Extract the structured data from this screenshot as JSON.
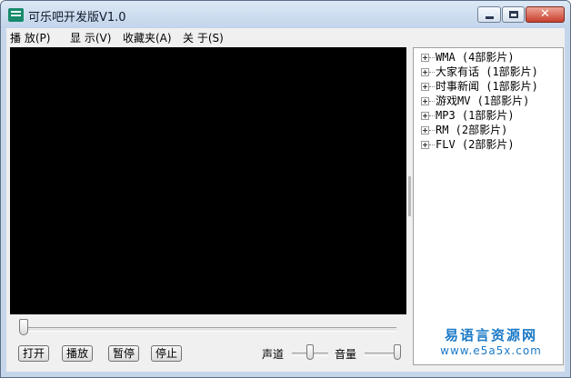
{
  "window": {
    "title": "可乐吧开发版V1.0",
    "buttons": {
      "minimize_icon": "minimize-icon",
      "maximize_icon": "maximize-icon",
      "close_glyph": "✕"
    }
  },
  "menu": [
    {
      "label": "播 放(P)"
    },
    {
      "label": "显 示(V)"
    },
    {
      "label": "收藏夹(A)"
    },
    {
      "label": "关 于(S)"
    }
  ],
  "tree": {
    "items": [
      {
        "label": "WMA  (4部影片)"
      },
      {
        "label": "大家有话  (1部影片)"
      },
      {
        "label": "时事新闻  (1部影片)"
      },
      {
        "label": "游戏MV  (1部影片)"
      },
      {
        "label": "MP3  (1部影片)"
      },
      {
        "label": "RM  (2部影片)"
      },
      {
        "label": "FLV  (2部影片)"
      }
    ]
  },
  "controls": {
    "seek_position": 0,
    "open_label": "打开",
    "play_label": "播放",
    "pause_label": "暂停",
    "stop_label": "停止",
    "balance_label": "声道",
    "balance_value": 0.5,
    "volume_label": "音量",
    "volume_value": 1.0
  },
  "watermark": {
    "name": "易语言资源网",
    "url": "www.e5a5x.com"
  },
  "colors": {
    "title_bar": "#c5d6ea",
    "video_background": "#000000",
    "close_button": "#c83f2c",
    "watermark": "#1a79c7"
  }
}
